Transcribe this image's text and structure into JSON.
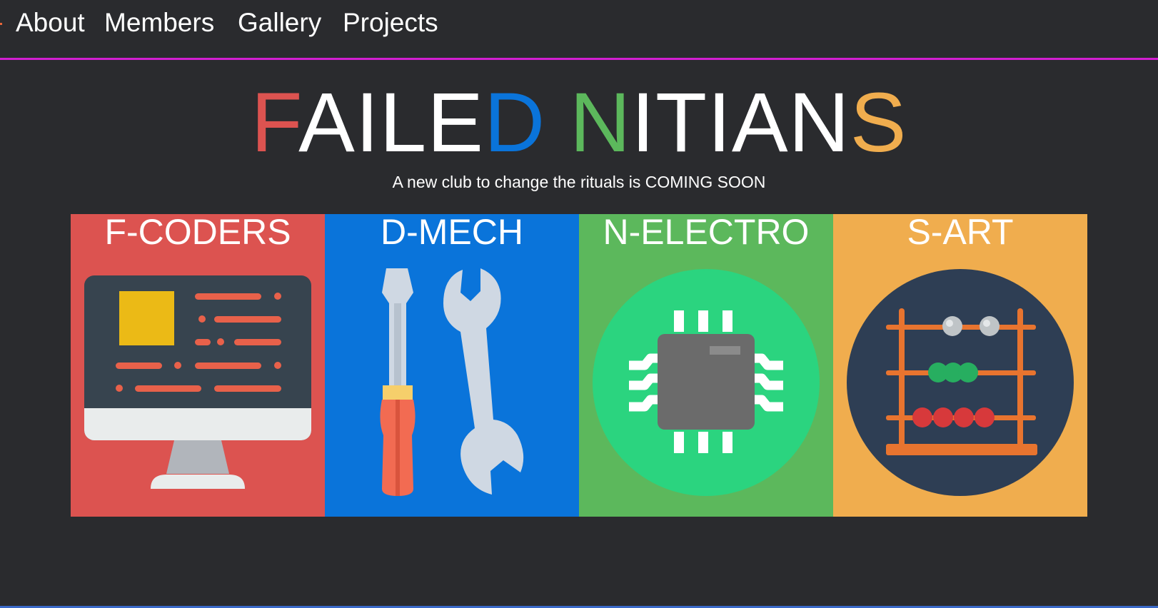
{
  "nav": {
    "items": [
      {
        "label": "About"
      },
      {
        "label": "Members"
      },
      {
        "label": "Gallery"
      },
      {
        "label": "Projects"
      }
    ]
  },
  "hero": {
    "title_letters": [
      {
        "ch": "F",
        "color": "#dc5350"
      },
      {
        "ch": "AILE",
        "color": "#ffffff"
      },
      {
        "ch": "D",
        "color": "#0a74da"
      },
      {
        "ch": " ",
        "color": "#ffffff"
      },
      {
        "ch": "N",
        "color": "#5cb85c"
      },
      {
        "ch": "ITIAN",
        "color": "#ffffff"
      },
      {
        "ch": "S",
        "color": "#f0ad4e"
      }
    ],
    "subtitle": "A new club to change the rituals is COMING SOON"
  },
  "panels": [
    {
      "label": "F-CODERS",
      "color": "#dc5350",
      "icon": "computer-monitor-icon"
    },
    {
      "label": "D-MECH",
      "color": "#0a74da",
      "icon": "tools-icon"
    },
    {
      "label": "N-ELECTRO",
      "color": "#5cb85c",
      "icon": "microchip-icon"
    },
    {
      "label": "S-ART",
      "color": "#f0ad4e",
      "icon": "abacus-icon"
    }
  ]
}
